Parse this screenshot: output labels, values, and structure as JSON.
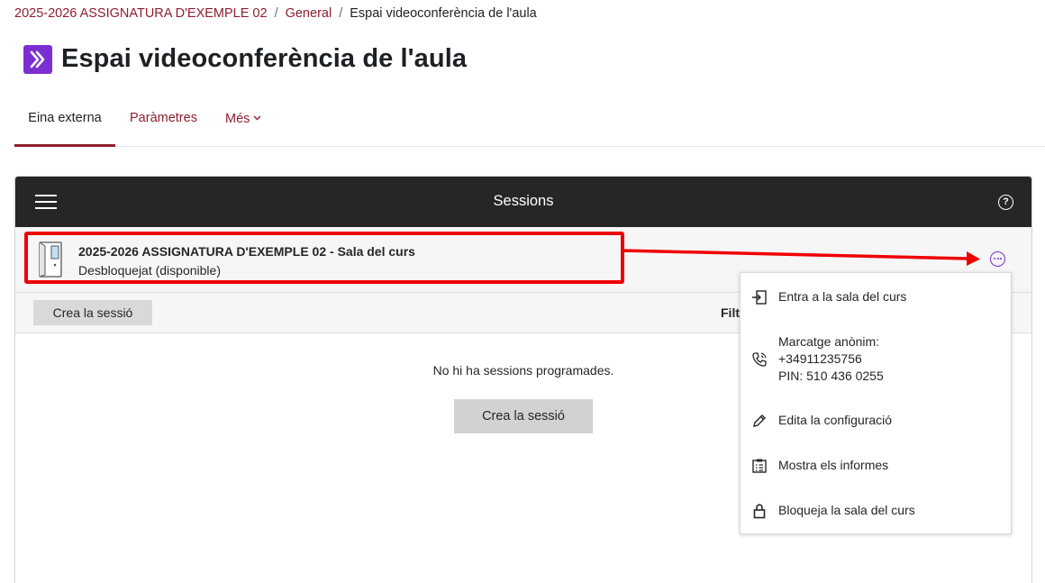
{
  "breadcrumb": {
    "course": "2025-2026 ASSIGNATURA D'EXEMPLE 02",
    "section": "General",
    "current": "Espai videoconferència de l'aula",
    "separator": "/"
  },
  "page": {
    "title": "Espai videoconferència de l'aula",
    "icon": "external-tool-icon"
  },
  "tabs": [
    {
      "label": "Eina externa",
      "active": true
    },
    {
      "label": "Paràmetres",
      "active": false
    },
    {
      "label": "Més",
      "active": false
    }
  ],
  "panel": {
    "title": "Sessions",
    "room": {
      "name": "2025-2026 ASSIGNATURA D'EXEMPLE 02 - Sala del curs",
      "status": "Desbloquejat (disponible)"
    },
    "toolbar": {
      "create_label": "Crea la sessió",
      "filter_label": "Filt"
    },
    "empty": {
      "message": "No hi ha sessions programades.",
      "create_label": "Crea la sessió"
    }
  },
  "menu": {
    "items": [
      {
        "label": "Entra a la sala del curs",
        "icon": "enter-icon"
      },
      {
        "label_lines": [
          "Marcatge anònim:",
          "+34911235756",
          "PIN: 510 436 0255"
        ],
        "icon": "phone-icon"
      },
      {
        "label": "Edita la configuració",
        "icon": "pencil-icon"
      },
      {
        "label": "Mostra els informes",
        "icon": "report-icon"
      },
      {
        "label": "Bloqueja la sala del curs",
        "icon": "lock-icon"
      }
    ]
  },
  "colors": {
    "brand": "#8f1e2d",
    "header_bg": "#262626",
    "accent_purple": "#7b2fd1",
    "highlight_red": "#ef0000"
  }
}
